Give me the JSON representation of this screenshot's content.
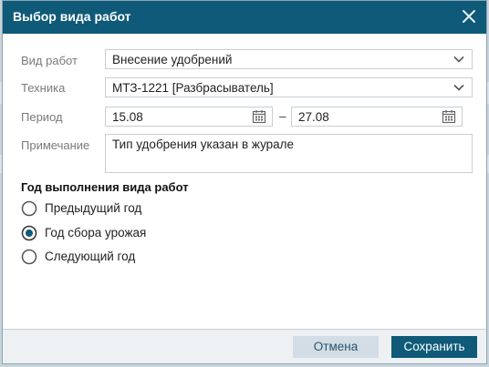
{
  "dialog": {
    "title": "Выбор вида работ",
    "fields": {
      "work_type": {
        "label": "Вид работ",
        "value": "Внесение удобрений"
      },
      "machinery": {
        "label": "Техника",
        "value": "МТЗ-1221 [Разбрасыватель]"
      },
      "period": {
        "label": "Период",
        "from": "15.08",
        "separator": "–",
        "to": "27.08"
      },
      "note": {
        "label": "Примечание",
        "value": "Тип удобрения указан в журале"
      }
    },
    "year_section": {
      "title": "Год выполнения вида работ",
      "options": [
        {
          "label": "Предыдущий год",
          "selected": false
        },
        {
          "label": "Год сбора урожая",
          "selected": true
        },
        {
          "label": "Следующий год",
          "selected": false
        }
      ]
    },
    "buttons": {
      "cancel": "Отмена",
      "save": "Сохранить"
    }
  },
  "colors": {
    "titlebar": "#0e5a78",
    "primary_button": "#0e5a78",
    "secondary_button": "#d3dde5"
  },
  "icons": [
    "close-icon",
    "chevron-down-icon",
    "calendar-icon",
    "radio-icon"
  ]
}
